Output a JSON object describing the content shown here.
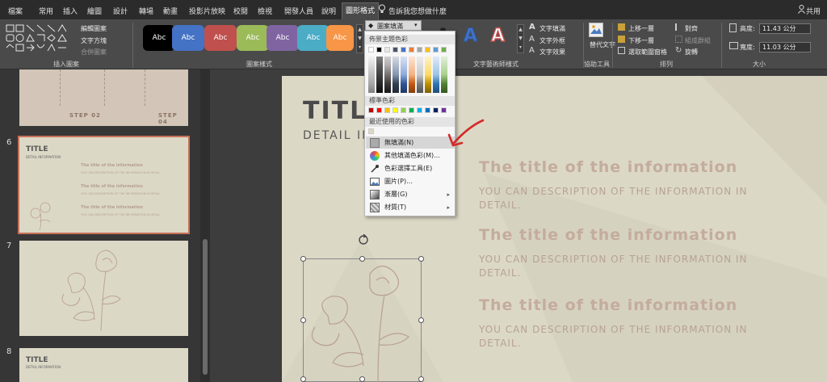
{
  "tabs": [
    {
      "label": "檔案"
    },
    {
      "label": "常用"
    },
    {
      "label": "插入"
    },
    {
      "label": "繪圖"
    },
    {
      "label": "設計"
    },
    {
      "label": "轉場"
    },
    {
      "label": "動畫"
    },
    {
      "label": "投影片放映"
    },
    {
      "label": "校閱"
    },
    {
      "label": "檢視"
    },
    {
      "label": "開發人員"
    },
    {
      "label": "說明"
    },
    {
      "label": "圖形格式"
    }
  ],
  "tellme": "告訴我您想做什麼",
  "account": "共用",
  "ribbon": {
    "insert_shapes": {
      "label": "插入圖案",
      "edit_shape": "編輯圖案",
      "text_box": "文字方塊",
      "merge_shapes": "合併圖案"
    },
    "shape_styles": {
      "label": "圖案樣式",
      "sample": "Abc",
      "fill": "圖案填滿",
      "outline": "文字外框",
      "effects": "文字效果"
    },
    "wordart": {
      "label": "文字藝術師樣式",
      "text_fill": "文字填滿",
      "text_outline": "文字外框",
      "text_effects": "文字效果",
      "letter": "A"
    },
    "accessibility": {
      "label": "協助工具",
      "alt_text": "替代文字"
    },
    "arrange": {
      "label": "排列",
      "bring_forward": "上移一層",
      "send_backward": "下移一層",
      "selection_pane": "選取範圍窗格",
      "align": "對齊",
      "group": "組成群組",
      "rotate": "旋轉"
    },
    "size": {
      "label": "大小",
      "height_label": "高度:",
      "height_value": "11.43 公分",
      "width_label": "寬度:",
      "width_value": "11.03 公分"
    }
  },
  "colors": {
    "shape_styles": [
      "#000000",
      "#4472c4",
      "#c0504d",
      "#9bbb59",
      "#8064a2",
      "#4bacc6",
      "#f79646"
    ],
    "theme_row": [
      "#ffffff",
      "#000000",
      "#e7e6e6",
      "#44546a",
      "#4472c4",
      "#ed7d31",
      "#a5a5a5",
      "#ffc000",
      "#5b9bd5",
      "#70ad47"
    ],
    "standard": [
      "#c00000",
      "#ff0000",
      "#ffc000",
      "#ffff00",
      "#92d050",
      "#00b050",
      "#00b0f0",
      "#0070c0",
      "#002060",
      "#7030a0"
    ],
    "recent": [
      "#dcd8c6"
    ],
    "arrow": "#d42a2a"
  },
  "dropdown": {
    "theme_colors_label": "佈景主題色彩",
    "standard_colors_label": "標準色彩",
    "recent_colors_label": "最近使用的色彩",
    "items": [
      {
        "label": "無填滿(N)",
        "icon": "no-fill-icon"
      },
      {
        "label": "其他填滿色彩(M)...",
        "icon": "color-palette-icon"
      },
      {
        "label": "色彩選擇工具(E)",
        "icon": "eyedropper-icon"
      },
      {
        "label": "圖片(P)...",
        "icon": "picture-icon"
      },
      {
        "label": "漸層(G)",
        "icon": "gradient-icon"
      },
      {
        "label": "材質(T)",
        "icon": "texture-icon"
      }
    ]
  },
  "thumbnails": [
    {
      "number": "",
      "steps": [
        "STEP 02",
        "STEP 04"
      ]
    },
    {
      "number": "6",
      "title": "TITLE",
      "subtitle": "DETAIL INFORMATION",
      "rows": [
        "The title of the information",
        "The title of the information",
        "The title of the information"
      ],
      "row_detail": "YOU CAN DESCRIPTION OF THE INFORMATION IN DETAIL."
    },
    {
      "number": "7"
    },
    {
      "number": "8",
      "title": "TITLE",
      "subtitle": "DETAIL INFORMATION"
    }
  ],
  "slide": {
    "title": "TITLE",
    "subtitle": "DETAIL INFORMATION",
    "items": [
      {
        "title": "The title of the information",
        "body": "YOU CAN DESCRIPTION OF THE INFORMATION IN DETAIL."
      },
      {
        "title": "The title of the information",
        "body": "YOU CAN DESCRIPTION OF THE INFORMATION IN DETAIL."
      },
      {
        "title": "The title of the information",
        "body": "YOU CAN DESCRIPTION OF THE INFORMATION IN DETAIL."
      }
    ]
  }
}
